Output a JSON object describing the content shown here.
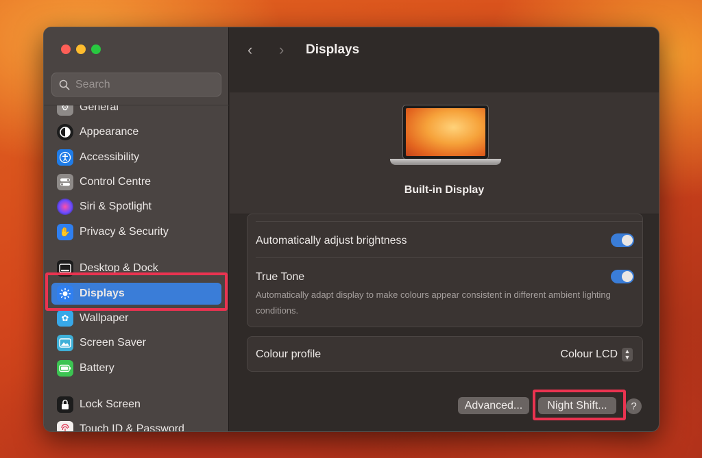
{
  "window": {
    "title": "Displays",
    "search": {
      "placeholder": "Search",
      "value": ""
    }
  },
  "sidebar": {
    "items": [
      {
        "label": "General",
        "icon": "gear-icon",
        "color": "#8e8a88"
      },
      {
        "label": "Appearance",
        "icon": "appearance-icon",
        "color": "#1c1c1c"
      },
      {
        "label": "Accessibility",
        "icon": "accessibility-icon",
        "color": "#1f7ce8"
      },
      {
        "label": "Control Centre",
        "icon": "control-centre-icon",
        "color": "#8e8a88"
      },
      {
        "label": "Siri & Spotlight",
        "icon": "siri-icon",
        "color": "#2b1e4a"
      },
      {
        "label": "Privacy & Security",
        "icon": "hand-icon",
        "color": "#2f7ff0"
      },
      {
        "label": "Desktop & Dock",
        "icon": "dock-icon",
        "color": "#1c1c1c"
      },
      {
        "label": "Displays",
        "icon": "sun-icon",
        "color": "#2f7ff0",
        "selected": true
      },
      {
        "label": "Wallpaper",
        "icon": "flower-icon",
        "color": "#38a8e8"
      },
      {
        "label": "Screen Saver",
        "icon": "screen-saver-icon",
        "color": "#3fb0d8"
      },
      {
        "label": "Battery",
        "icon": "battery-icon",
        "color": "#3cc452"
      },
      {
        "label": "Lock Screen",
        "icon": "lock-icon",
        "color": "#1c1c1c"
      },
      {
        "label": "Touch ID & Password",
        "icon": "fingerprint-icon",
        "color": "#f4f0ee"
      }
    ]
  },
  "main": {
    "display_name": "Built-in Display",
    "settings": {
      "auto_brightness": {
        "label": "Automatically adjust brightness",
        "on": true
      },
      "true_tone": {
        "label": "True Tone",
        "description": "Automatically adapt display to make colours appear consistent in different ambient lighting conditions.",
        "on": true
      },
      "colour_profile": {
        "label": "Colour profile",
        "value": "Colour LCD"
      }
    },
    "buttons": {
      "advanced": "Advanced...",
      "night_shift": "Night Shift...",
      "help": "?"
    }
  }
}
